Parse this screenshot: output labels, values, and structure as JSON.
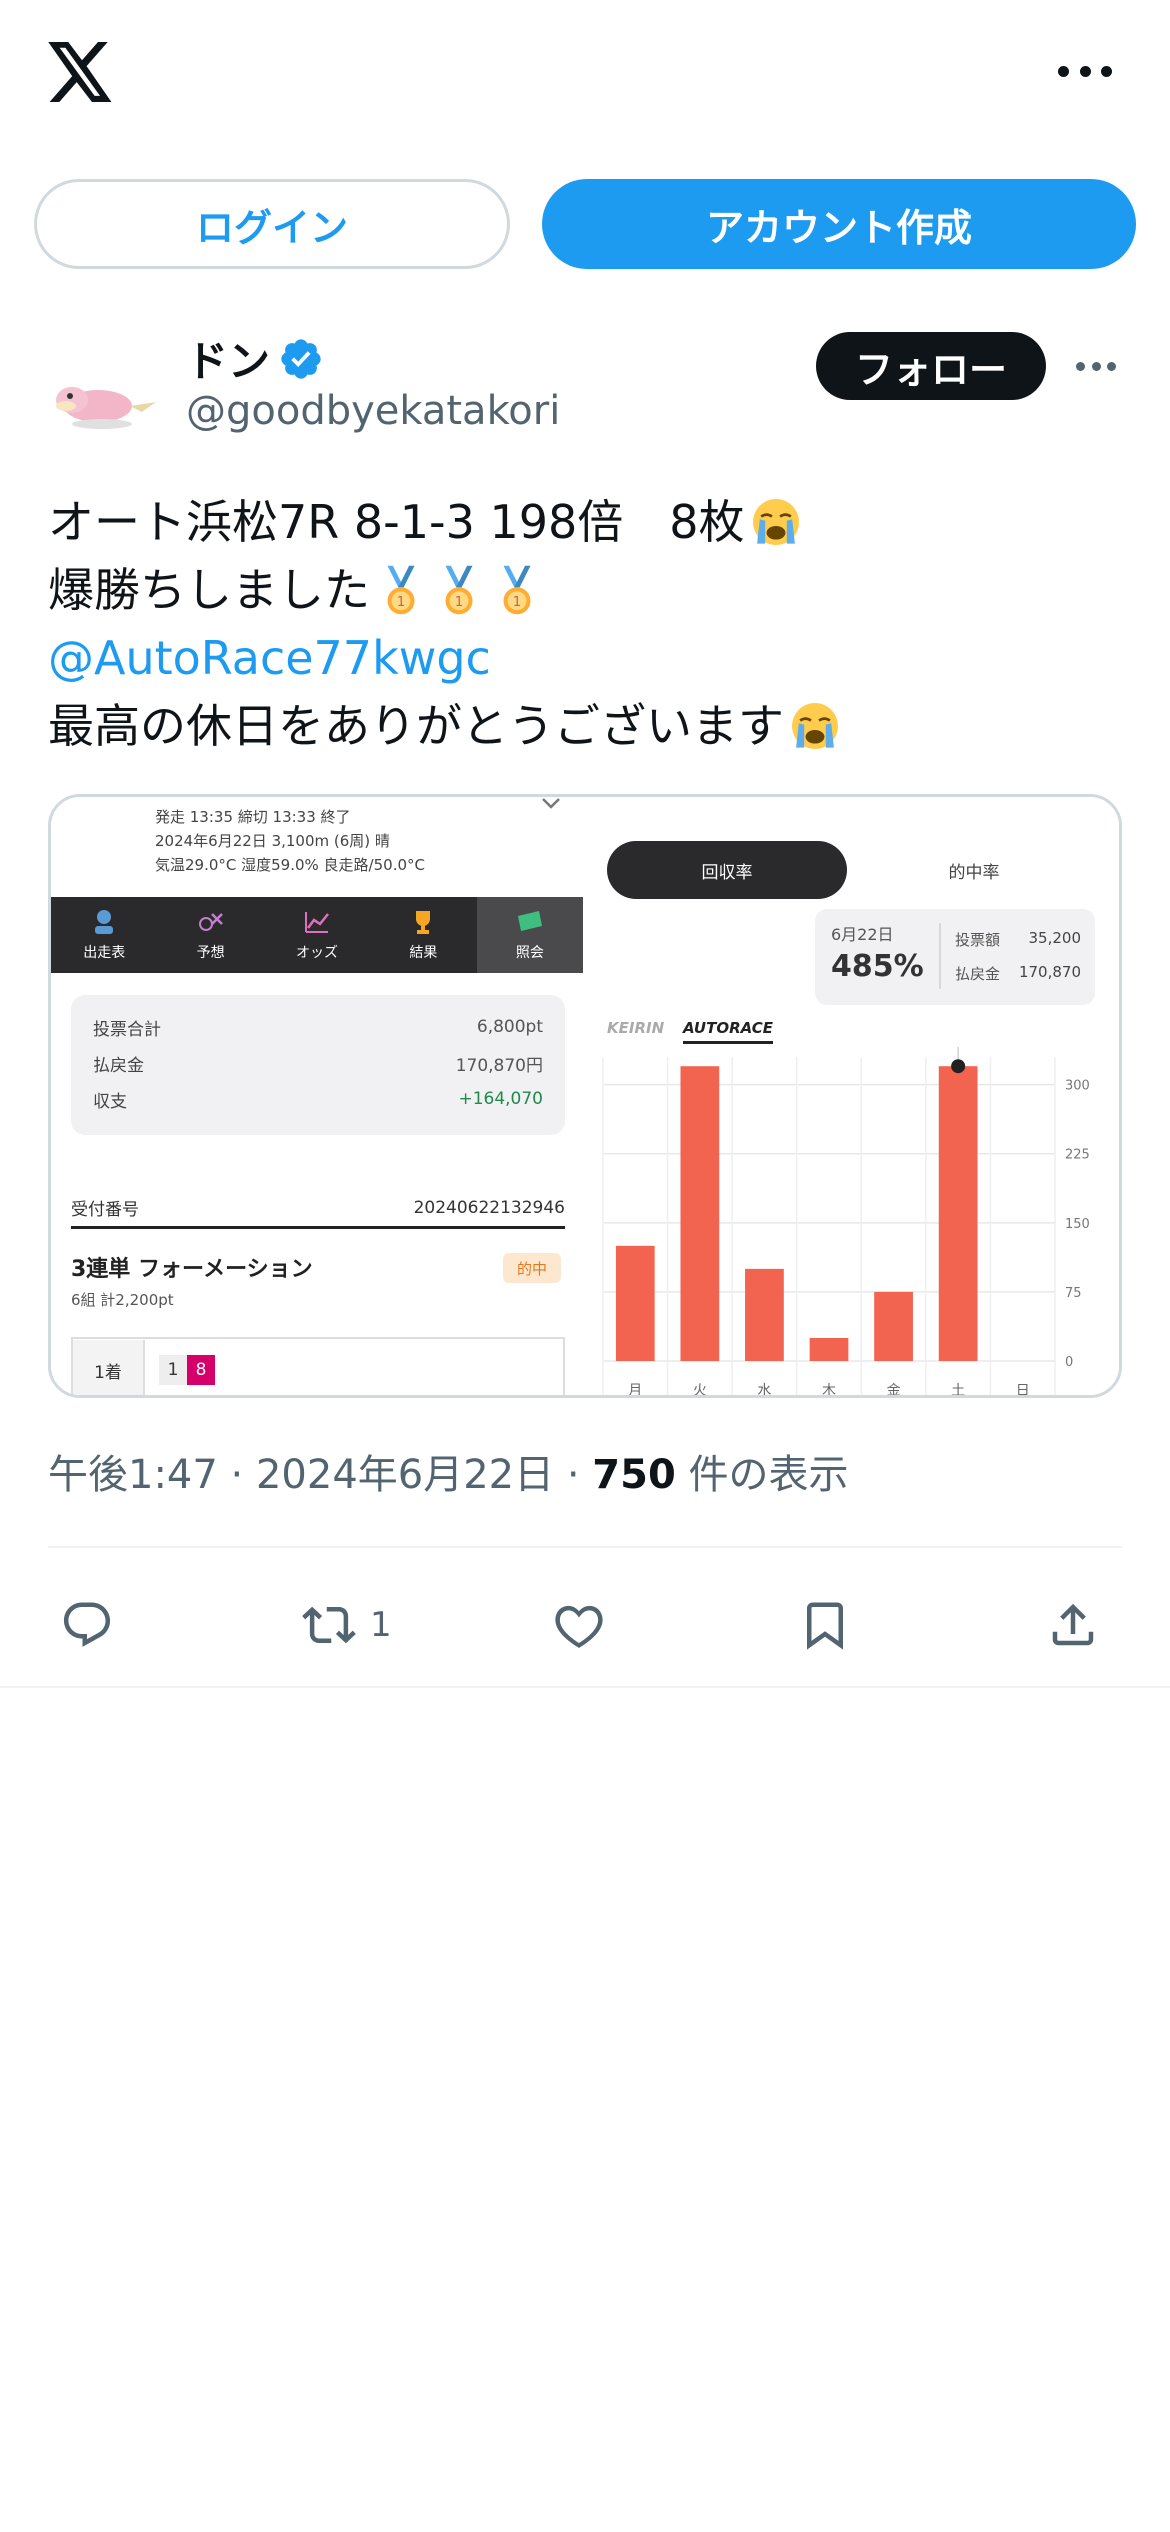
{
  "header": {
    "logo_icon": "x-logo-icon",
    "more_icon": "more-horizontal-icon"
  },
  "auth": {
    "login_label": "ログイン",
    "signup_label": "アカウント作成"
  },
  "author": {
    "display_name": "ドン",
    "handle": "@goodbyekatakori",
    "verified": true,
    "follow_label": "フォロー"
  },
  "post": {
    "line1": "オート浜松7R 8-1-3 198倍　8枚",
    "line2": "爆勝ちしました",
    "mention": "@AutoRace77kwgc",
    "line4": "最高の休日をありがとうございます"
  },
  "media": {
    "race_info": {
      "line1": "発走 13:35 締切 13:33  終了",
      "line2": "2024年6月22日 3,100m (6周) 晴",
      "line3": "気温29.0°C 湿度59.0% 良走路/50.0°C"
    },
    "tabs": [
      {
        "label": "出走表",
        "icon": "rider-icon"
      },
      {
        "label": "予想",
        "icon": "forecast-icon"
      },
      {
        "label": "オッズ",
        "icon": "odds-chart-icon"
      },
      {
        "label": "結果",
        "icon": "trophy-icon"
      },
      {
        "label": "照会",
        "icon": "ticket-icon"
      }
    ],
    "summary": {
      "bet_total_label": "投票合計",
      "bet_total": "6,800pt",
      "payout_label": "払戻金",
      "payout": "170,870円",
      "balance_label": "収支",
      "balance": "+164,070"
    },
    "receipt_label": "受付番号",
    "receipt_number": "20240622132946",
    "bet_type": "3連単 フォーメーション",
    "hit_badge": "的中",
    "bet_detail": "6組 計2,200pt",
    "position_label": "1着",
    "numbers": [
      "1",
      "8"
    ],
    "segment_on": "回収率",
    "segment_off": "的中率",
    "tooltip": {
      "date": "6月22日",
      "rate": "485%",
      "bet_label": "投票額",
      "bet": "35,200",
      "payout_label": "払戻金",
      "payout": "170,870"
    },
    "brand_keirin": "KEIRIN",
    "brand_autorace": "AUTORACE"
  },
  "chart_data": {
    "type": "bar",
    "categories": [
      "月",
      "火",
      "水",
      "木",
      "金",
      "土",
      "日"
    ],
    "values": [
      125,
      320,
      100,
      25,
      75,
      320,
      0
    ],
    "yticks": [
      0,
      75,
      150,
      225,
      300
    ],
    "ylim": [
      0,
      330
    ],
    "bar_color": "#f26450",
    "highlight_index": 5
  },
  "meta": {
    "time": "午後1:47",
    "sep": " · ",
    "date": "2024年6月22日",
    "views": "750",
    "views_suffix": " 件の表示"
  },
  "actions": {
    "reply_icon": "reply-icon",
    "repost_icon": "repost-icon",
    "repost_count": "1",
    "like_icon": "heart-icon",
    "bookmark_icon": "bookmark-icon",
    "share_icon": "share-icon"
  },
  "colors": {
    "accent": "#1d9bf0",
    "text": "#0f1419",
    "secondary": "#536471"
  }
}
